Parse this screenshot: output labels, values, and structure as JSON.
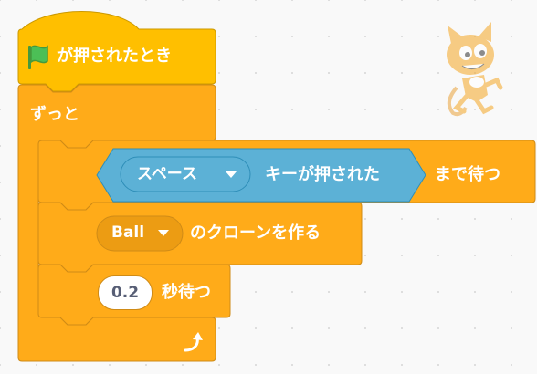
{
  "workspace": {
    "background_color": "#f9f9f9",
    "dot_color": "#dcdcdc"
  },
  "colors": {
    "events": "#FFBF00",
    "control": "#FFAB19",
    "control_field": "#EC9C13",
    "sensing": "#5CB1D6",
    "flag_green": "#4CBF56"
  },
  "script": {
    "hat": {
      "icon": "green-flag-icon",
      "label": "が押されたとき"
    },
    "forever": {
      "label": "ずっと",
      "loop_icon": "loop-arrow-icon"
    },
    "wait_until": {
      "label_suffix": "まで待つ",
      "condition": {
        "key_value": "スペース",
        "label": "キーが押された"
      }
    },
    "create_clone": {
      "target_value": "Ball",
      "label": "のクローンを作る"
    },
    "wait": {
      "value": "0.2",
      "label": "秒待つ"
    }
  },
  "sprite": {
    "name": "scratch-cat-icon"
  }
}
